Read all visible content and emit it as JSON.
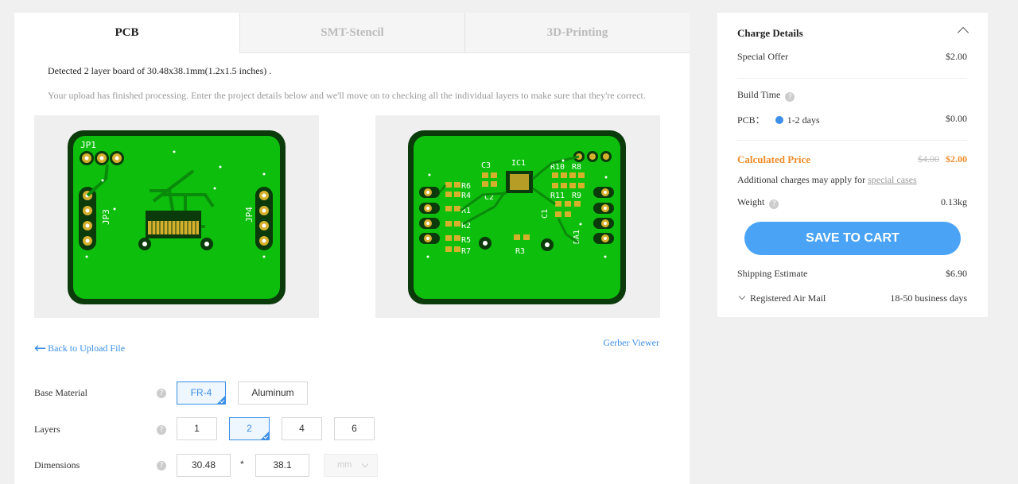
{
  "tabs": [
    {
      "label": "PCB",
      "active": true
    },
    {
      "label": "SMT-Stencil",
      "active": false
    },
    {
      "label": "3D-Printing",
      "active": false
    }
  ],
  "upload": {
    "detected": "Detected 2 layer board of 30.48x38.1mm(1.2x1.5 inches) .",
    "note": "Your upload has finished processing. Enter the project details below and we'll move on to checking all the individual layers to make sure that they're correct."
  },
  "boards": {
    "top_labels": [
      "JP1",
      "JP3",
      "JP4"
    ],
    "bottom_labels": [
      "C3",
      "IC1",
      "R10",
      "R8",
      "R6",
      "R4",
      "C2",
      "R11",
      "R9",
      "R1",
      "R2",
      "R5",
      "R7",
      "R3",
      "C1",
      "DA1"
    ]
  },
  "links": {
    "back": "Back to Upload File",
    "gerber": "Gerber Viewer"
  },
  "form": {
    "base_material": {
      "label": "Base Material",
      "options": [
        "FR-4",
        "Aluminum"
      ],
      "selected": "FR-4"
    },
    "layers": {
      "label": "Layers",
      "options": [
        "1",
        "2",
        "4",
        "6"
      ],
      "selected": "2"
    },
    "dimensions": {
      "label": "Dimensions",
      "width": "30.48",
      "sep": "*",
      "height": "38.1",
      "unit": "mm"
    }
  },
  "charge": {
    "title": "Charge Details",
    "special_offer_label": "Special Offer",
    "special_offer_value": "$2.00",
    "build_time_label": "Build Time",
    "pcb_label": "PCB：",
    "pcb_option": "1-2 days",
    "pcb_value": "$0.00",
    "calculated_label": "Calculated Price",
    "calculated_old": "$4.00",
    "calculated_new": "$2.00",
    "additional_prefix": "Additional charges may apply for ",
    "additional_link": "special cases",
    "weight_label": "Weight",
    "weight_value": "0.13kg",
    "cart_button": "SAVE TO CART",
    "shipping_label": "Shipping Estimate",
    "shipping_value": "$6.90",
    "mail_label": "Registered Air Mail",
    "mail_value": "18-50 business days"
  },
  "colors": {
    "accent": "#3b8fe6",
    "button": "#4aa3f5",
    "price": "#f08c2a",
    "pcb_green": "#0dbe0d",
    "pcb_edge": "#0b3a0b",
    "pad_gold": "#d5b02c"
  }
}
